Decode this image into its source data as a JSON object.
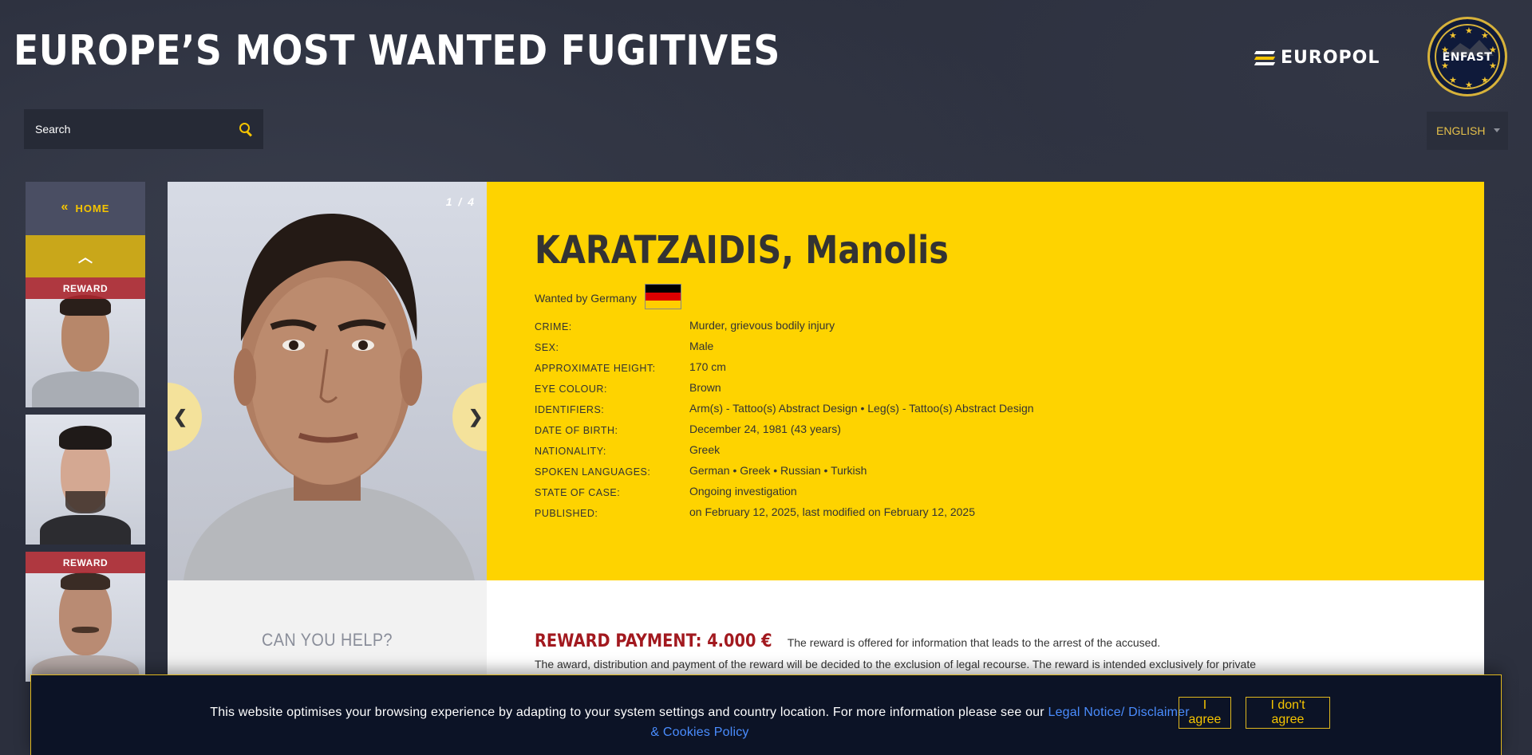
{
  "header": {
    "title": "EUROPE’S MOST WANTED FUGITIVES",
    "europol_logo_text": "EUROPOL",
    "enfast_logo_text": "ENFAST"
  },
  "search": {
    "placeholder": "Search"
  },
  "language": {
    "selected": "ENGLISH"
  },
  "sidebar": {
    "home_label": "HOME",
    "home_chevron": "«",
    "up_chevron": "︿",
    "thumbnails": [
      {
        "reward": true,
        "reward_label": "REWARD"
      },
      {
        "reward": false,
        "reward_label": ""
      },
      {
        "reward": true,
        "reward_label": "REWARD"
      }
    ]
  },
  "profile": {
    "photo_counter": "1 / 4",
    "prev_arrow": "❮",
    "next_arrow": "❯",
    "name": "KARATZAIDIS, Manolis",
    "wanted_by": "Wanted by Germany",
    "flag": "germany-flag",
    "details": [
      {
        "label": "Crime:",
        "value": "Murder, grievous bodily injury"
      },
      {
        "label": "Sex:",
        "value": "Male"
      },
      {
        "label": "Approximate height:",
        "value": "170 cm"
      },
      {
        "label": "Eye colour:",
        "value": "Brown"
      },
      {
        "label": "Identifiers:",
        "value": "Arm(s) - Tattoo(s) Abstract Design • Leg(s) - Tattoo(s) Abstract Design"
      },
      {
        "label": "Date of birth:",
        "value": "December 24, 1981 (43 years)"
      },
      {
        "label": "Nationality:",
        "value": "Greek"
      },
      {
        "label": "Spoken languages:",
        "value": "German • Greek • Russian • Turkish"
      },
      {
        "label": "State of case:",
        "value": "Ongoing investigation"
      },
      {
        "label": "Published:",
        "value": "on February 12, 2025, last modified on February 12, 2025"
      }
    ]
  },
  "help": {
    "title": "CAN YOU HELP?"
  },
  "reward": {
    "heading": "REWARD PAYMENT: 4.000 €",
    "summary": "The reward is offered for information that leads to the arrest of the accused.",
    "paragraph": "The award, distribution and payment of the reward will be decided to the exclusion of legal recourse. The reward is intended exclusively for private"
  },
  "cookie_banner": {
    "text": "This website optimises your browsing experience by adapting to your system settings and country location. For more information please see our ",
    "link_text": "Legal Notice/ Disclaimer & Cookies Policy",
    "agree_label": "I agree",
    "disagree_label": "I don't agree"
  },
  "colors": {
    "accent_yellow": "#fed300",
    "reward_red": "#a2191f",
    "background": "#2b2f3d",
    "link_blue": "#4a8dff"
  }
}
